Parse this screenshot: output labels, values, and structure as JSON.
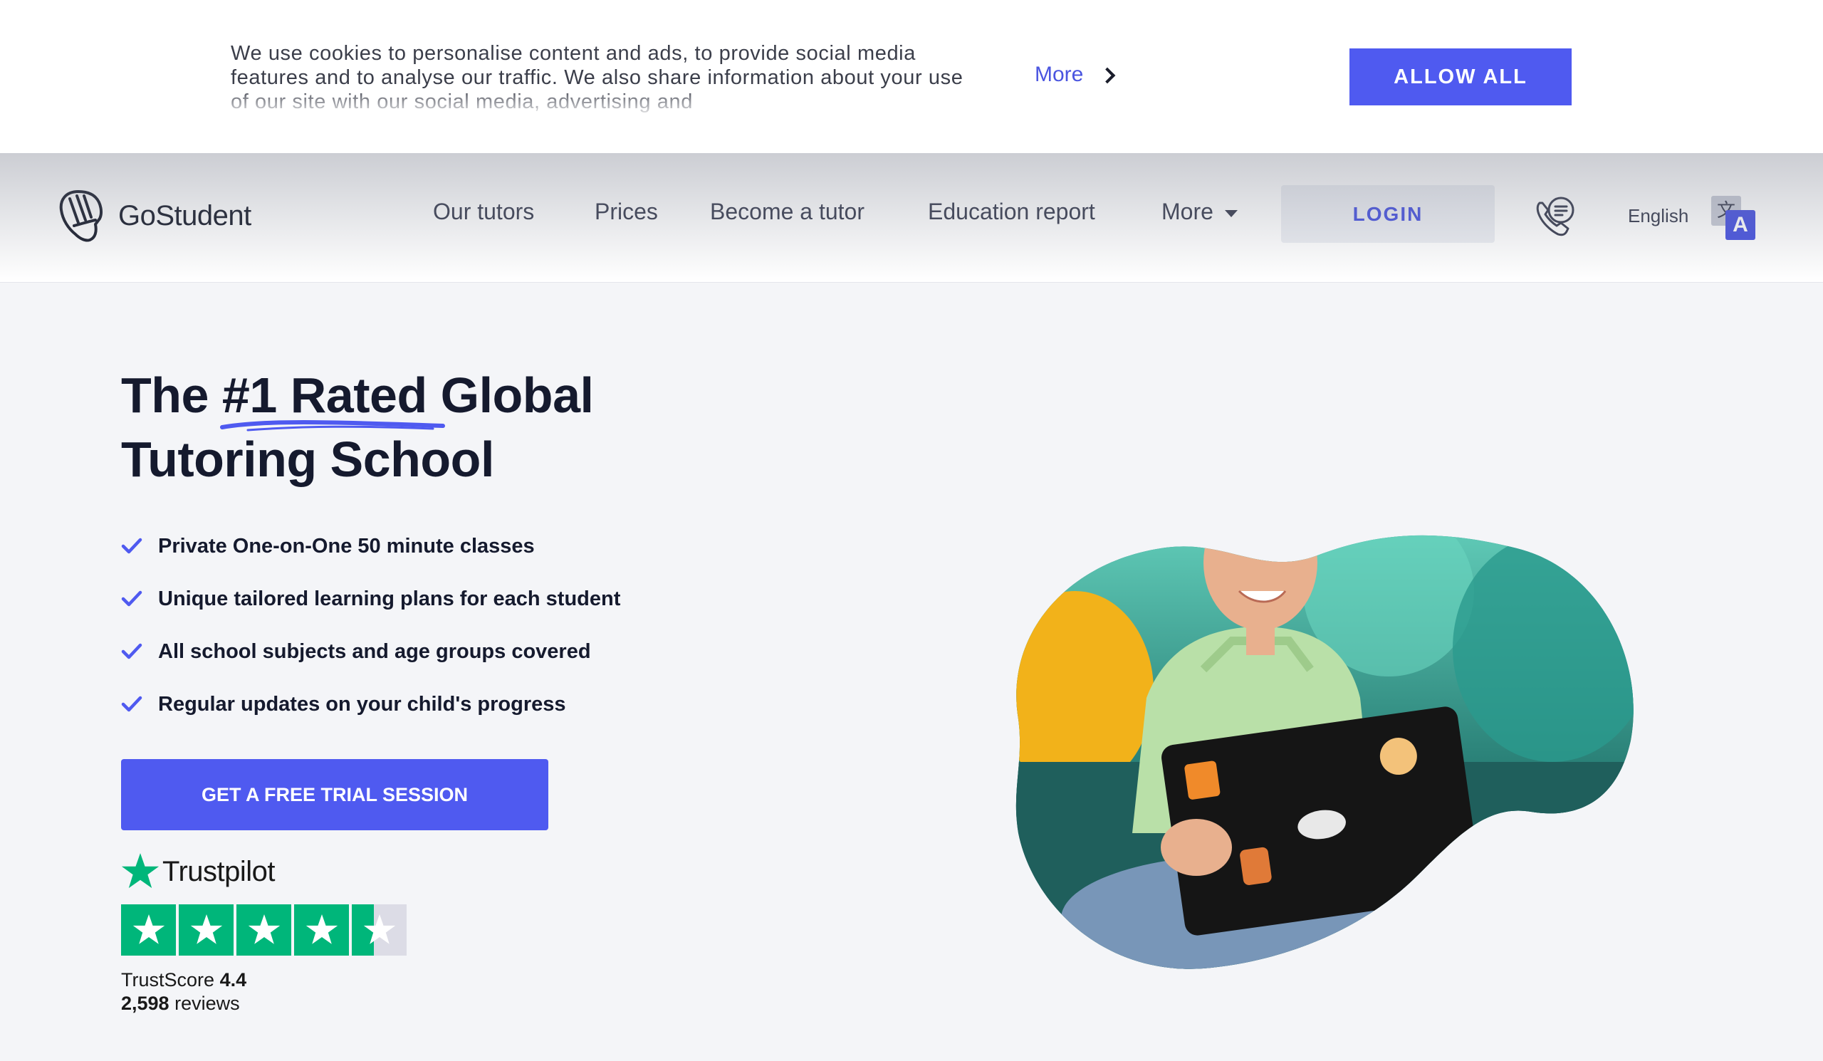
{
  "cookie": {
    "text": "We use cookies to personalise content and ads, to provide social media features and to analyse our traffic. We also share information about your use of our site with our social media, advertising and",
    "more_label": "More",
    "allow_label": "ALLOW ALL"
  },
  "header": {
    "logo_text": "GoStudent",
    "nav": [
      {
        "label": "Our tutors"
      },
      {
        "label": "Prices"
      },
      {
        "label": "Become a tutor"
      },
      {
        "label": "Education report"
      },
      {
        "label": "More"
      }
    ],
    "login_label": "LOGIN",
    "language": "English",
    "translate_icon_back": "文",
    "translate_icon_front": "A"
  },
  "hero": {
    "title_part1": "The ",
    "title_highlight": "#1 Rated",
    "title_part2": " Global",
    "title_line2": "Tutoring School",
    "bullets": [
      "Private One-on-One 50 minute classes",
      "Unique tailored learning plans for each student",
      "All school subjects and age groups covered",
      "Regular updates on your child's progress"
    ],
    "cta_label": "GET A FREE TRIAL SESSION"
  },
  "trustpilot": {
    "name": "Trustpilot",
    "score_label": "TrustScore",
    "score_value": "4.4",
    "reviews_count": "2,598",
    "reviews_label": " reviews",
    "rating": 4.4
  },
  "colors": {
    "accent": "#4f5af0",
    "trustpilot_green": "#00b67a",
    "text_dark": "#151a2e"
  }
}
